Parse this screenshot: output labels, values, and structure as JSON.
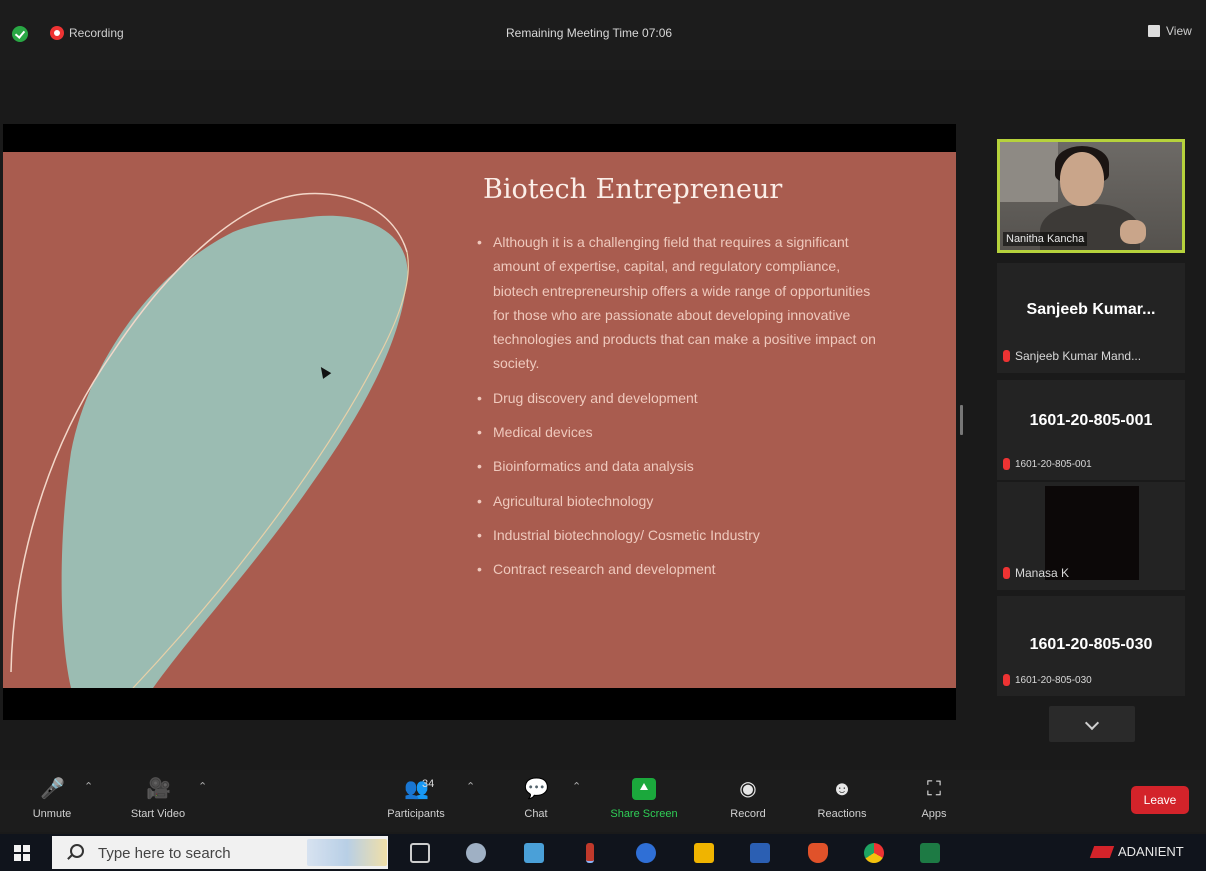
{
  "topbar": {
    "recording_label": "Recording",
    "meeting_time": "Remaining Meeting Time 07:06",
    "view_label": "View"
  },
  "slide": {
    "title": "Biotech Entrepreneur",
    "bullets": [
      "Although it is a challenging field that requires a significant amount of expertise, capital, and regulatory compliance, biotech entrepreneurship offers a wide range of opportunities for those who are passionate about developing innovative technologies and products that can make a positive impact on society.",
      "Drug discovery and development",
      "Medical devices",
      "Bioinformatics and data analysis",
      "Agricultural biotechnology",
      "Industrial biotechnology/ Cosmetic Industry",
      "Contract research and development"
    ],
    "colors": {
      "background": "#a95c4f",
      "blob": "#9bbcb2",
      "outline": "#f3d7c9",
      "title": "#fbeee8",
      "text": "#efc9bd"
    }
  },
  "participants": {
    "active_speaker": "Nanitha Kancha",
    "tiles": [
      {
        "big": "Sanjeeb  Kumar...",
        "small": "Sanjeeb Kumar Mand..."
      },
      {
        "big": "1601-20-805-001",
        "small": "1601-20-805-001"
      },
      {
        "big": "",
        "small": "Manasa K"
      },
      {
        "big": "1601-20-805-030",
        "small": "1601-20-805-030"
      }
    ]
  },
  "toolbar": {
    "unmute": "Unmute",
    "start_video": "Start Video",
    "participants": "Participants",
    "participants_count": "34",
    "chat": "Chat",
    "share_screen": "Share Screen",
    "record": "Record",
    "reactions": "Reactions",
    "apps": "Apps",
    "leave": "Leave"
  },
  "taskbar": {
    "search_placeholder": "Type here to search",
    "tray_label": "ADANIENT"
  }
}
